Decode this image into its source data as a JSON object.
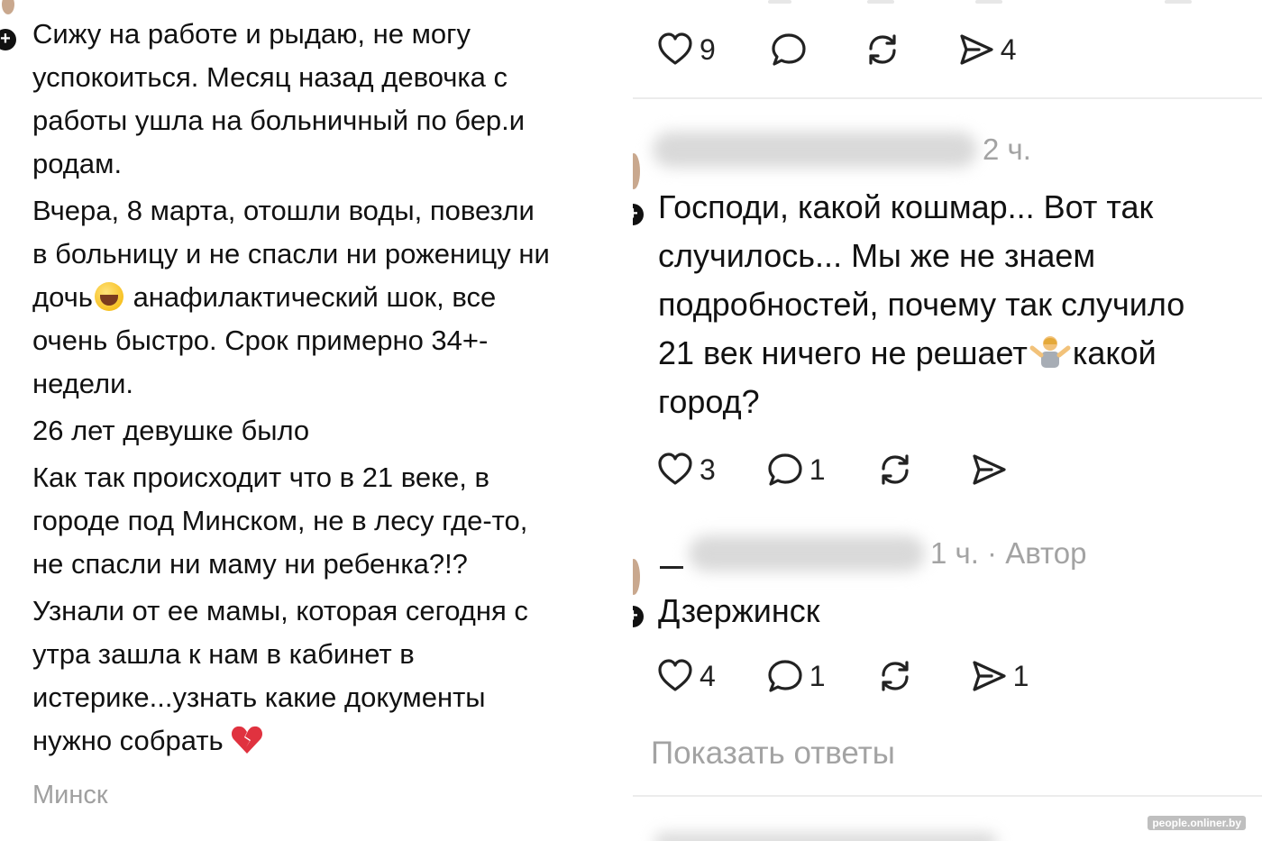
{
  "post": {
    "paragraphs": [
      "Сижу на работе и рыдаю, не могу\nуспокоиться. Месяц назад девочка с\nработы ушла на больничный по бер.и\nродам.",
      "Вчера, 8 марта, отошли воды, повезли\nв больницу и не спасли ни роженицу ни\nдочь",
      "26 лет девушке было",
      "Как так происходит что в 21 веке, в\nгороде под Минском, не в лесу где-то,\nне спасли ни маму ни ребенка?!?",
      "Узнали от ее мамы, которая сегодня с\nутра зашла к нам в кабинет в\nистерике...узнать какие документы\nнужно собрать"
    ],
    "paragraph2_tail": " анафилактический шок, все\nочень быстро. Срок примерно 34+-\nнедели.",
    "location": "Минск",
    "plus_icon": "+",
    "emoji_crying": "loudly-crying-face",
    "emoji_heart": "broken-heart"
  },
  "post_actions": {
    "likes": "9",
    "comments": "",
    "reposts": "",
    "shares": "4"
  },
  "comments": [
    {
      "time": "2 ч.",
      "text_part1": "Господи, какой кошмар... Вот так\nслучилось... Мы же не знаем\nподробностей, почему так случило\n21 век ничего не решает",
      "text_part2": "какой\nгород?",
      "emoji": "person-shrugging",
      "likes": "3",
      "replies": "1",
      "reposts": "",
      "shares": ""
    },
    {
      "time": "1 ч. · Автор",
      "text": "Дзержинск",
      "likes": "4",
      "replies": "1",
      "reposts": "",
      "shares": "1"
    }
  ],
  "show_replies": "Показать ответы",
  "watermark": "people.onliner.by",
  "colors": {
    "text": "#111111",
    "muted": "#a3a3a3",
    "divider": "#ececec",
    "background": "#ffffff"
  }
}
